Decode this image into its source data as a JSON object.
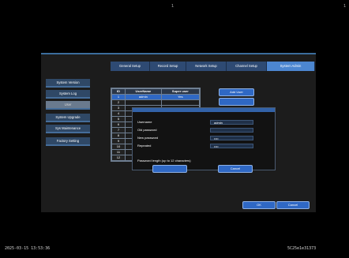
{
  "top_marks": [
    "1",
    "1"
  ],
  "tabs": [
    {
      "label": "General Setup",
      "active": false
    },
    {
      "label": "Record Setup",
      "active": false
    },
    {
      "label": "Network Setup",
      "active": false
    },
    {
      "label": "Channel Setup",
      "active": false
    },
    {
      "label": "System Admin",
      "active": true
    }
  ],
  "sidebar": {
    "items": [
      {
        "label": "System Version",
        "active": false
      },
      {
        "label": "System Log",
        "active": false
      },
      {
        "label": "User",
        "active": true
      },
      {
        "label": "System Upgrade",
        "active": false
      },
      {
        "label": "Sys Maintenance",
        "active": false
      },
      {
        "label": "Factory Setting",
        "active": false
      }
    ]
  },
  "user_table": {
    "headers": [
      "ID",
      "UserName",
      "Super user"
    ],
    "rows": [
      {
        "id": "1",
        "username": "admin",
        "super": "Yes"
      },
      {
        "id": "2",
        "username": "",
        "super": ""
      },
      {
        "id": "3",
        "username": "",
        "super": ""
      },
      {
        "id": "4",
        "username": "",
        "super": ""
      },
      {
        "id": "5",
        "username": "",
        "super": ""
      },
      {
        "id": "6",
        "username": "",
        "super": ""
      },
      {
        "id": "7",
        "username": "",
        "super": ""
      },
      {
        "id": "8",
        "username": "",
        "super": ""
      },
      {
        "id": "9",
        "username": "",
        "super": ""
      },
      {
        "id": "10",
        "username": "",
        "super": ""
      },
      {
        "id": "11",
        "username": "",
        "super": ""
      },
      {
        "id": "12",
        "username": "",
        "super": ""
      }
    ]
  },
  "buttons": {
    "add_user": "Add User",
    "modify": "",
    "modify_ok": "",
    "cancel_small": "Cancel",
    "ok": "OK",
    "cancel_main": "Cancel"
  },
  "password_dialog": {
    "username_label": "Username",
    "username_value": "admin",
    "old_password_label": "Old password",
    "old_password_value": "",
    "new_password_label": "New password",
    "new_password_value": "••••",
    "repeated_label": "Repeated",
    "repeated_value": "••••",
    "hint": "Password length (up to 12 characters)"
  },
  "status_bar": {
    "datetime": "2025-03-15 13:53:36",
    "device_id": "5C25e1e31373"
  }
}
